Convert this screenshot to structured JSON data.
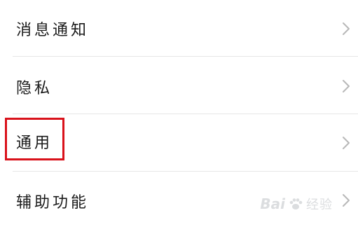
{
  "settings": {
    "items": [
      {
        "label": "消息通知",
        "icon": "chevron-right-icon"
      },
      {
        "label": "隐私",
        "icon": "chevron-right-icon"
      },
      {
        "label": "通用",
        "icon": "chevron-right-icon",
        "highlighted": true
      },
      {
        "label": "辅助功能",
        "icon": "chevron-right-icon"
      }
    ]
  },
  "annotation": {
    "highlight_color": "#d9121b"
  },
  "watermark": {
    "brand": "Bai",
    "text": "经验"
  },
  "colors": {
    "background": "#ffffff",
    "text": "#1a1a1a",
    "chevron": "#b8b8b8",
    "divider": "#e6e6e6"
  }
}
